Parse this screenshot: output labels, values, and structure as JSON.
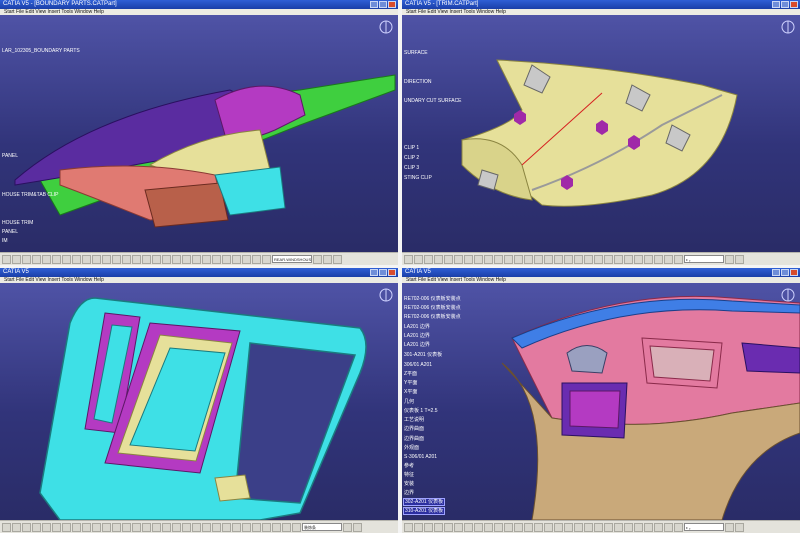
{
  "panels": {
    "top_left": {
      "window_title": "CATIA V5 - [BOUNDARY PARTS.CATPart]",
      "menu": "Start  File  Edit  View  Insert  Tools  Window  Help",
      "tree": [
        "LAR_102305_BOUNDARY PARTS",
        "PANEL",
        "HOUSE TRIM&TAB CLIP",
        "HOUSE TRIM",
        "PANEL",
        "IM"
      ],
      "toolbar_select": "REAR.WINDSHOUSE.TRIM"
    },
    "top_right": {
      "window_title": "CATIA V5 - [TRIM.CATPart]",
      "menu": "Start  File  Edit  View  Insert  Tools  Window  Help",
      "tree": [
        "SURFACE",
        "DIRECTION",
        "UNDARY CUT SURFACE",
        "CLIP 1",
        "CLIP 2",
        "CLIP 3",
        "STING CLIP"
      ],
      "toolbar_select": "ε 。"
    },
    "bottom_left": {
      "window_title": "CATIA V5",
      "menu": "Start  File  Edit  View  Insert  Tools  Window  Help",
      "toolbar_select": "装饰条"
    },
    "bottom_right": {
      "window_title": "CATIA V5",
      "menu": "Start  File  Edit  View  Insert  Tools  Window  Help",
      "tree": [
        "RE702-006 仪表板安装点",
        "RE702-006 仪表板安装点",
        "RE702-006 仪表板安装点",
        "LA201 边界",
        "LA201 边界",
        "LA201 边界",
        "301-A201 仪表板",
        "306/01 A201",
        "Z平面",
        "Y平面",
        "X平面",
        "几何",
        "仪表板 1 T=2.5",
        "工艺说明",
        "边界曲面",
        "边界曲面",
        "外观面",
        "S·306/01 A201",
        "参考",
        "特征",
        "安装",
        "边界",
        "302-A201 仪表板",
        "310-A201 仪表板"
      ],
      "toolbar_select": "ε 。"
    }
  },
  "colors": {
    "background": "#3b3f88",
    "titlebar": "#2f5fd6",
    "green_part": "#3fcf3f",
    "purple_part": "#b43ac2",
    "violet_part": "#5a2ca0",
    "salmon_part": "#e07a72",
    "cyan_part": "#3ee0e6",
    "beige_part": "#e6e09a",
    "tan_part": "#c9a97a",
    "pink_part": "#e37aa0",
    "blue_part": "#3f7ee6"
  },
  "icons": [
    "window-minimize-icon",
    "window-maximize-icon",
    "window-close-icon",
    "compass-icon",
    "toolbar-button-icon"
  ]
}
